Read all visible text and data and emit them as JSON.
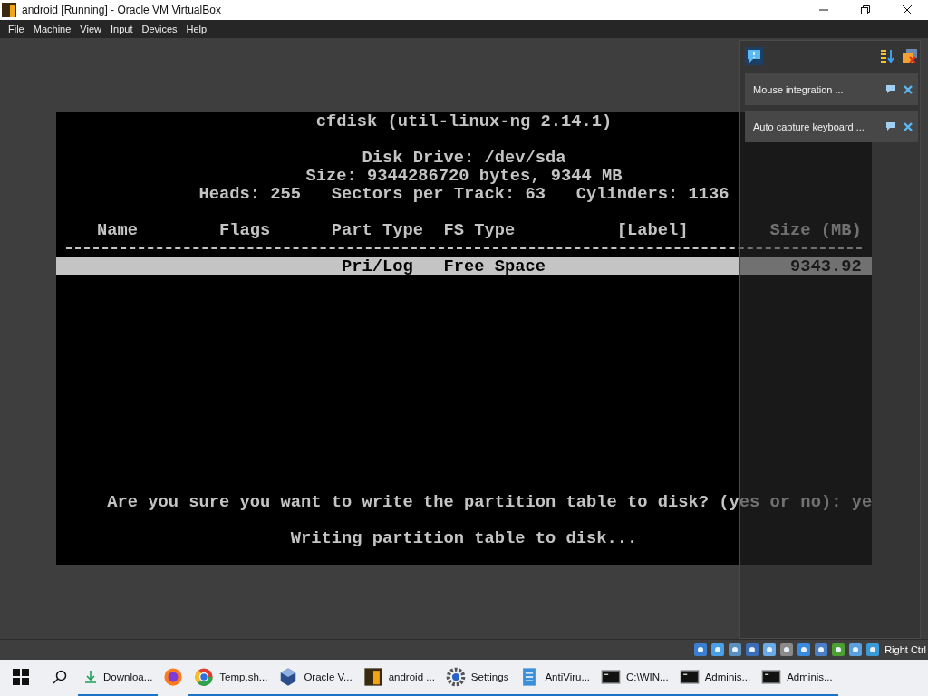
{
  "window": {
    "title": "android [Running] - Oracle VM VirtualBox"
  },
  "menu": [
    "File",
    "Machine",
    "View",
    "Input",
    "Devices",
    "Help"
  ],
  "terminal": {
    "title": "cfdisk (util-linux-ng 2.14.1)",
    "info": [
      "Disk Drive: /dev/sda",
      "Size: 9344286720 bytes, 9344 MB",
      "Heads: 255   Sectors per Track: 63   Cylinders: 1136"
    ],
    "columns": [
      "Name",
      "Flags",
      "Part Type",
      "FS Type",
      "[Label]",
      "Size (MB)"
    ],
    "rows": [
      {
        "part_type": "Pri/Log",
        "fs_type": "Free Space",
        "size": "9343.92",
        "selected": true
      }
    ],
    "prompt": "Are you sure you want to write the partition table to disk? (yes or no): ye",
    "status": "Writing partition table to disk..."
  },
  "notifications": [
    {
      "text": "Mouse integration ..."
    },
    {
      "text": "Auto capture keyboard ..."
    }
  ],
  "status_bar": {
    "host_key": "Right Ctrl"
  },
  "taskbar": [
    {
      "kind": "download",
      "label": "Downloa...",
      "running": true
    },
    {
      "kind": "fox",
      "running": false
    },
    {
      "kind": "ring",
      "label": "Temp.sh...",
      "running": true
    },
    {
      "kind": "cube",
      "label": "Oracle V...",
      "running": true
    },
    {
      "kind": "app",
      "label": "android ...",
      "running": true
    },
    {
      "kind": "gear",
      "label": "Settings",
      "running": true
    },
    {
      "kind": "notepad",
      "label": "AntiViru...",
      "running": true
    },
    {
      "kind": "console",
      "label": "C:\\WIN...",
      "running": true
    },
    {
      "kind": "console",
      "label": "Adminis...",
      "running": true
    },
    {
      "kind": "console",
      "label": "Adminis...",
      "running": true
    }
  ]
}
